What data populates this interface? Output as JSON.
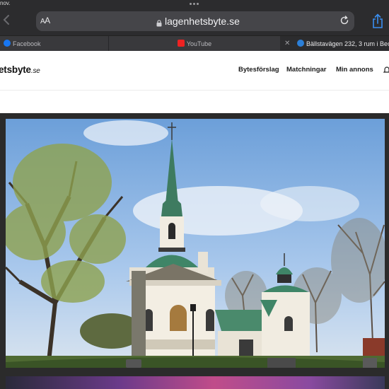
{
  "status": {
    "time_fragment": "nov."
  },
  "browser": {
    "aa_label": "AA",
    "url": "lagenhetsbyte.se",
    "tabs": [
      {
        "label": "Facebook",
        "icon": "facebook-icon"
      },
      {
        "label": "YouTube",
        "icon": "youtube-icon"
      },
      {
        "label": "Bällstavägen 232, 3 rum i Bec",
        "icon": "lagenhetsbyte-icon",
        "active": true
      }
    ]
  },
  "site": {
    "logo": "etsbyte",
    "logo_suffix": ".se",
    "nav": [
      "Bytesförslag",
      "Matchningar",
      "Min annons"
    ]
  },
  "colors": {
    "chrome": "#2c2c2e",
    "address_bar": "#454549",
    "sky": "#8fb6e6",
    "roof": "#4f8a6e"
  }
}
